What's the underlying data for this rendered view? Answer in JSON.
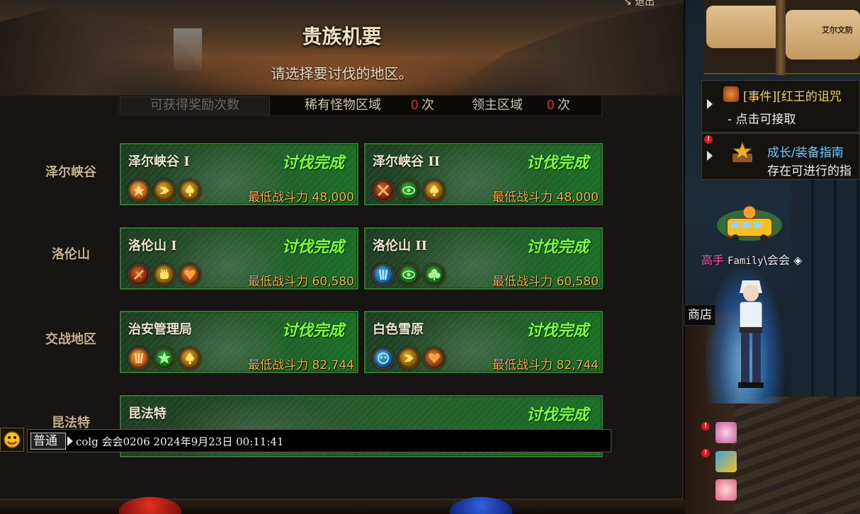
{
  "dialog": {
    "title": "贵族机要",
    "subtitle": "请选择要讨伐的地区。",
    "exit_label": "退出"
  },
  "reward_bar": {
    "label": "可获得奖励次数",
    "rare_label": "稀有怪物区域",
    "rare_count": "0",
    "rare_unit": "次",
    "lord_label": "领主区域",
    "lord_count": "0",
    "lord_unit": "次"
  },
  "regions": [
    {
      "label": "泽尔峡谷",
      "dungeons": [
        {
          "name": "泽尔峡谷 I",
          "status": "讨伐完成",
          "power": "最低战斗力 48,000",
          "icons": [
            "orange-crest-icon",
            "gold-arrow-icon",
            "gold-spade-icon"
          ]
        },
        {
          "name": "泽尔峡谷 II",
          "status": "讨伐完成",
          "power": "最低战斗力 48,000",
          "icons": [
            "crossed-swords-icon",
            "green-eye-icon",
            "gold-spade-icon"
          ]
        }
      ]
    },
    {
      "label": "洛伦山",
      "dungeons": [
        {
          "name": "洛伦山 I",
          "status": "讨伐完成",
          "power": "最低战斗力 60,580",
          "icons": [
            "red-slash-icon",
            "gold-fist-icon",
            "orange-heart-icon"
          ]
        },
        {
          "name": "洛伦山 II",
          "status": "讨伐完成",
          "power": "最低战斗力 60,580",
          "icons": [
            "blue-claw-icon",
            "green-eye-icon",
            "green-club-icon"
          ]
        }
      ]
    },
    {
      "label": "交战地区",
      "dungeons": [
        {
          "name": "治安管理局",
          "status": "讨伐完成",
          "power": "最低战斗力 82,744",
          "icons": [
            "orange-claw-icon",
            "green-star-icon",
            "gold-spade-icon"
          ]
        },
        {
          "name": "白色雪原",
          "status": "讨伐完成",
          "power": "最低战斗力 82,744",
          "icons": [
            "blue-mask-icon",
            "gold-arrow-icon",
            "orange-heart-icon"
          ]
        }
      ]
    },
    {
      "label": "昆法特",
      "dungeons": [
        {
          "name": "昆法特",
          "status": "讨伐完成",
          "power": "",
          "icons": []
        }
      ]
    }
  ],
  "chat": {
    "channel": "普通",
    "message": "colg 会会0206 2024年9月23日 00:11:41"
  },
  "minimap": {
    "town_label": "艾尔文防"
  },
  "quests": {
    "event_title": "[事件][红王的诅咒",
    "event_sub": "- 点击可接取",
    "guide_title": "成长/装备指南",
    "guide_sub": "存在可进行的指"
  },
  "player": {
    "guild_tag": "高手",
    "family": "Family",
    "name": "\\会会"
  },
  "shop_label": "商店",
  "colors": {
    "status_green": "#7cff3a",
    "power_gold": "#f0b840",
    "zero_red": "#e02a1c",
    "card_border": "#2f7d2c",
    "quest_yellow": "#f2d050",
    "guide_blue": "#6cc8ff"
  }
}
